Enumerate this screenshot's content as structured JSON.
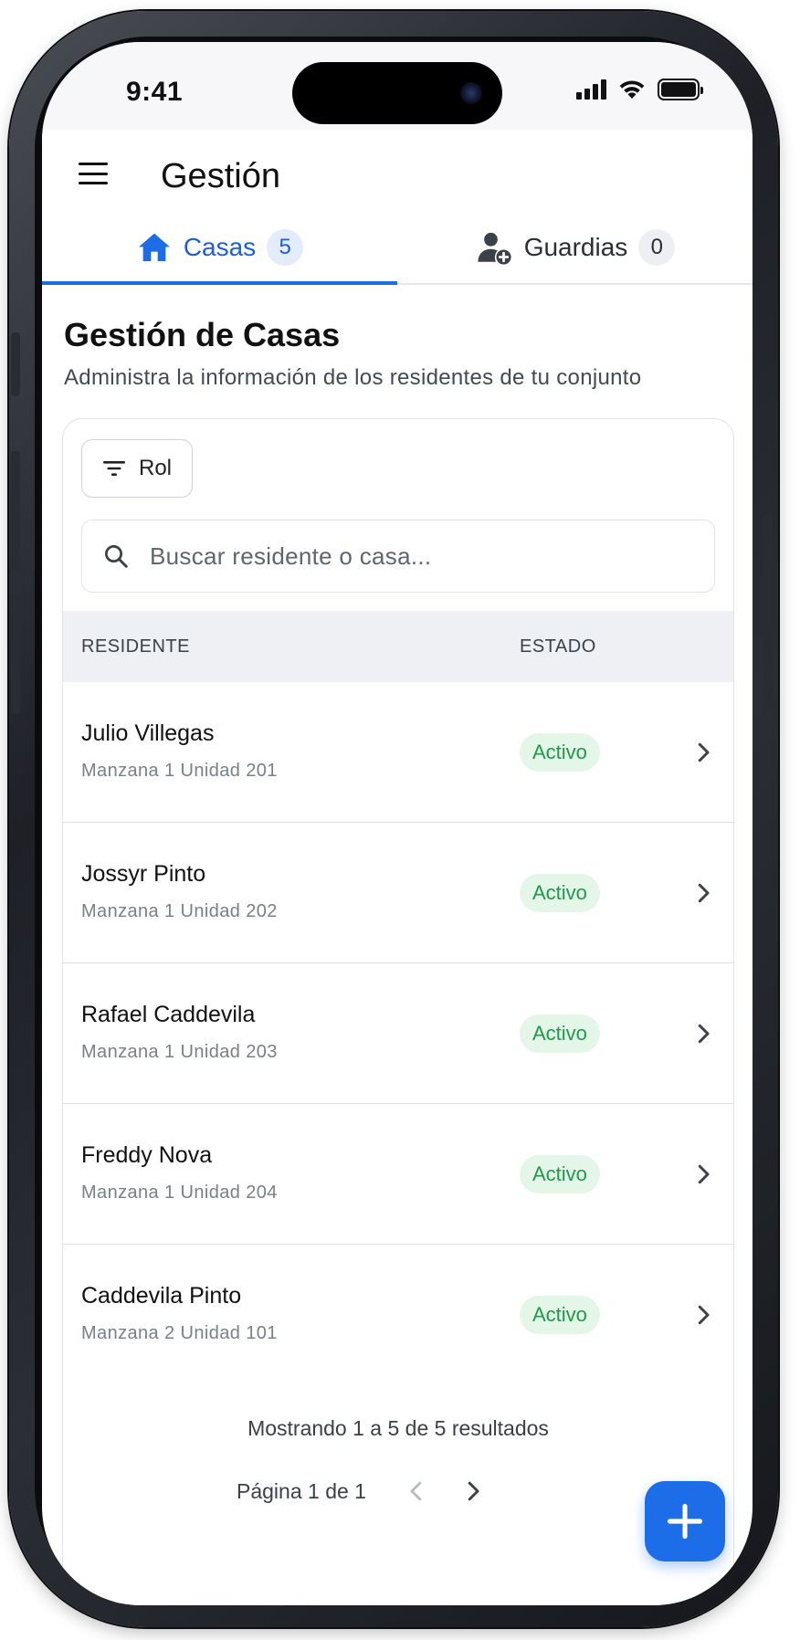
{
  "status_bar": {
    "time": "9:41",
    "icons": [
      "cellular-signal-icon",
      "wifi-icon",
      "battery-icon"
    ]
  },
  "header": {
    "menu_icon": "hamburger-menu-icon",
    "title": "Gestión"
  },
  "tabs": [
    {
      "icon": "house-icon",
      "label": "Casas",
      "count": "5",
      "active": true
    },
    {
      "icon": "add-user-icon",
      "label": "Guardias",
      "count": "0",
      "active": false
    }
  ],
  "section": {
    "title": "Gestión de Casas",
    "subtitle": "Administra la información de los residentes de tu conjunto"
  },
  "filter": {
    "icon": "filter-icon",
    "label": "Rol"
  },
  "search": {
    "icon": "search-icon",
    "placeholder": "Buscar residente o casa..."
  },
  "table": {
    "columns": [
      "RESIDENTE",
      "ESTADO"
    ],
    "rows": [
      {
        "name": "Julio Villegas",
        "unit": "Manzana 1 Unidad 201",
        "status": "Activo"
      },
      {
        "name": "Jossyr Pinto",
        "unit": "Manzana 1 Unidad 202",
        "status": "Activo"
      },
      {
        "name": "Rafael Caddevila",
        "unit": "Manzana 1 Unidad 203",
        "status": "Activo"
      },
      {
        "name": "Freddy Nova",
        "unit": "Manzana 1 Unidad 204",
        "status": "Activo"
      },
      {
        "name": "Caddevila Pinto",
        "unit": "Manzana 2 Unidad 101",
        "status": "Activo"
      }
    ]
  },
  "pagination": {
    "results_text": "Mostrando 1 a 5 de 5 resultados",
    "page_text": "Página 1 de 1"
  },
  "fab": {
    "icon": "plus-icon"
  },
  "colors": {
    "accent": "#1d6de8",
    "active_tab_text": "#1d5fd6",
    "status_active_bg": "#e3f6e8",
    "status_active_text": "#1f9a4b"
  }
}
